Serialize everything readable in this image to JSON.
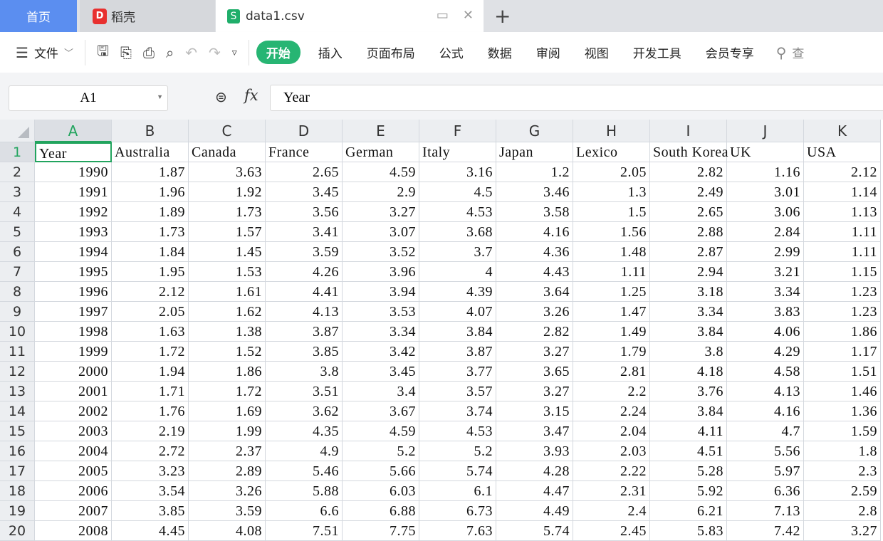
{
  "tabs": {
    "home": "首页",
    "daoke": "稻壳",
    "file": "data1.csv"
  },
  "toolbar": {
    "file_menu": "文件",
    "menus": [
      "开始",
      "插入",
      "页面布局",
      "公式",
      "数据",
      "审阅",
      "视图",
      "开发工具",
      "会员专享"
    ],
    "search": "查"
  },
  "formula_bar": {
    "cell_ref": "A1",
    "value": "Year"
  },
  "colors": {
    "accent": "#27b573",
    "home_tab": "#5b8ef0"
  },
  "columns": [
    "A",
    "B",
    "C",
    "D",
    "E",
    "F",
    "G",
    "H",
    "I",
    "J",
    "K"
  ],
  "header": [
    "Year",
    "Australia",
    "Canada",
    "France",
    "German",
    "Italy",
    "Japan",
    "Lexico",
    "South Korea",
    "UK",
    "USA"
  ],
  "rows": [
    [
      "1990",
      "1.87",
      "3.63",
      "2.65",
      "4.59",
      "3.16",
      "1.2",
      "2.05",
      "2.82",
      "1.16",
      "2.12"
    ],
    [
      "1991",
      "1.96",
      "1.92",
      "3.45",
      "2.9",
      "4.5",
      "3.46",
      "1.3",
      "2.49",
      "3.01",
      "1.14"
    ],
    [
      "1992",
      "1.89",
      "1.73",
      "3.56",
      "3.27",
      "4.53",
      "3.58",
      "1.5",
      "2.65",
      "3.06",
      "1.13"
    ],
    [
      "1993",
      "1.73",
      "1.57",
      "3.41",
      "3.07",
      "3.68",
      "4.16",
      "1.56",
      "2.88",
      "2.84",
      "1.11"
    ],
    [
      "1994",
      "1.84",
      "1.45",
      "3.59",
      "3.52",
      "3.7",
      "4.36",
      "1.48",
      "2.87",
      "2.99",
      "1.11"
    ],
    [
      "1995",
      "1.95",
      "1.53",
      "4.26",
      "3.96",
      "4",
      "4.43",
      "1.11",
      "2.94",
      "3.21",
      "1.15"
    ],
    [
      "1996",
      "2.12",
      "1.61",
      "4.41",
      "3.94",
      "4.39",
      "3.64",
      "1.25",
      "3.18",
      "3.34",
      "1.23"
    ],
    [
      "1997",
      "2.05",
      "1.62",
      "4.13",
      "3.53",
      "4.07",
      "3.26",
      "1.47",
      "3.34",
      "3.83",
      "1.23"
    ],
    [
      "1998",
      "1.63",
      "1.38",
      "3.87",
      "3.34",
      "3.84",
      "2.82",
      "1.49",
      "3.84",
      "4.06",
      "1.86"
    ],
    [
      "1999",
      "1.72",
      "1.52",
      "3.85",
      "3.42",
      "3.87",
      "3.27",
      "1.79",
      "3.8",
      "4.29",
      "1.17"
    ],
    [
      "2000",
      "1.94",
      "1.86",
      "3.8",
      "3.45",
      "3.77",
      "3.65",
      "2.81",
      "4.18",
      "4.58",
      "1.51"
    ],
    [
      "2001",
      "1.71",
      "1.72",
      "3.51",
      "3.4",
      "3.57",
      "3.27",
      "2.2",
      "3.76",
      "4.13",
      "1.46"
    ],
    [
      "2002",
      "1.76",
      "1.69",
      "3.62",
      "3.67",
      "3.74",
      "3.15",
      "2.24",
      "3.84",
      "4.16",
      "1.36"
    ],
    [
      "2003",
      "2.19",
      "1.99",
      "4.35",
      "4.59",
      "4.53",
      "3.47",
      "2.04",
      "4.11",
      "4.7",
      "1.59"
    ],
    [
      "2004",
      "2.72",
      "2.37",
      "4.9",
      "5.2",
      "5.2",
      "3.93",
      "2.03",
      "4.51",
      "5.56",
      "1.8"
    ],
    [
      "2005",
      "3.23",
      "2.89",
      "5.46",
      "5.66",
      "5.74",
      "4.28",
      "2.22",
      "5.28",
      "5.97",
      "2.3"
    ],
    [
      "2006",
      "3.54",
      "3.26",
      "5.88",
      "6.03",
      "6.1",
      "4.47",
      "2.31",
      "5.92",
      "6.36",
      "2.59"
    ],
    [
      "2007",
      "3.85",
      "3.59",
      "6.6",
      "6.88",
      "6.73",
      "4.49",
      "2.4",
      "6.21",
      "7.13",
      "2.8"
    ],
    [
      "2008",
      "4.45",
      "4.08",
      "7.51",
      "7.75",
      "7.63",
      "5.74",
      "2.45",
      "5.83",
      "7.42",
      "3.27"
    ]
  ]
}
